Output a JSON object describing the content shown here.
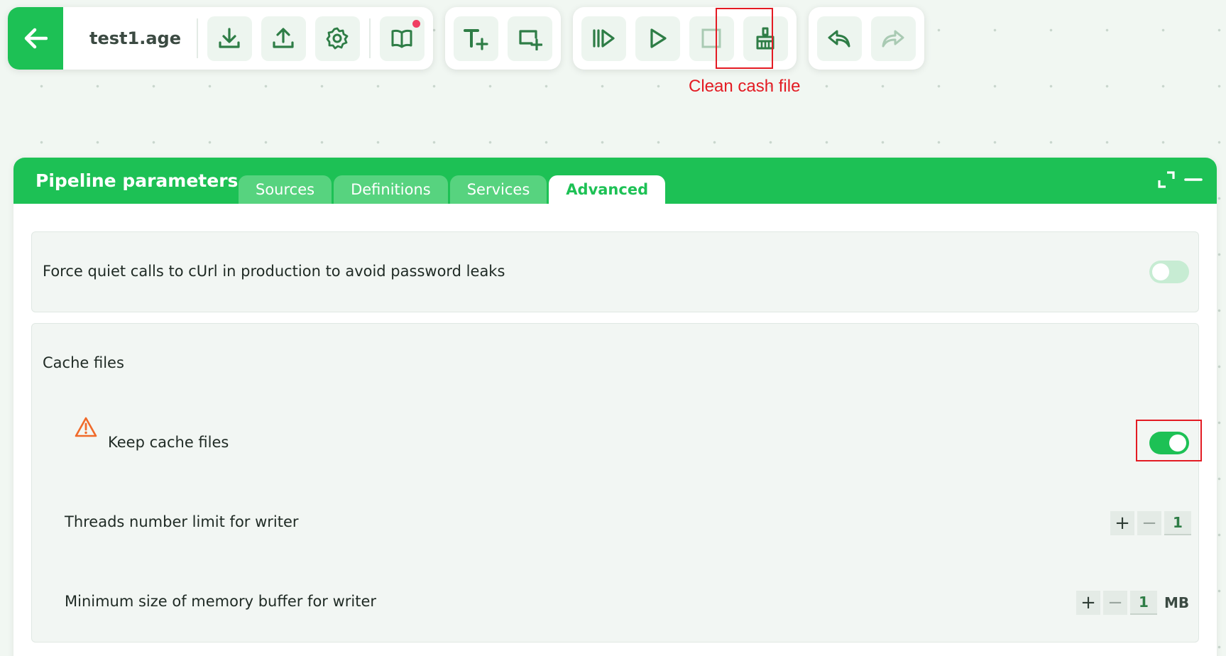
{
  "toolbar": {
    "file_name": "test1.age",
    "groups": [
      {
        "buttons": [
          {
            "icon": "download-icon",
            "disabled": false
          },
          {
            "icon": "upload-icon",
            "disabled": false
          },
          {
            "icon": "gear-icon",
            "disabled": false
          },
          {
            "icon": "book-icon",
            "disabled": false,
            "badge": true
          }
        ]
      },
      {
        "buttons": [
          {
            "icon": "text-add-icon",
            "disabled": false
          },
          {
            "icon": "frame-add-icon",
            "disabled": false
          }
        ]
      },
      {
        "buttons": [
          {
            "icon": "step-run-icon",
            "disabled": false
          },
          {
            "icon": "play-icon",
            "disabled": false
          },
          {
            "icon": "stop-icon",
            "disabled": true
          },
          {
            "icon": "broom-icon",
            "disabled": false
          }
        ]
      },
      {
        "buttons": [
          {
            "icon": "undo-icon",
            "disabled": false
          },
          {
            "icon": "redo-icon",
            "disabled": true
          }
        ]
      }
    ]
  },
  "annotation": {
    "callout": "Clean cash file",
    "color": "#e31b23"
  },
  "panel": {
    "title": "Pipeline parameters",
    "tabs": [
      {
        "label": "Sources",
        "active": false
      },
      {
        "label": "Definitions",
        "active": false
      },
      {
        "label": "Services",
        "active": false
      },
      {
        "label": "Advanced",
        "active": true
      }
    ],
    "force_quiet": {
      "label": "Force quiet calls to cUrl in production to avoid password leaks",
      "enabled": false
    },
    "cache": {
      "section_label": "Cache files",
      "keep_cache": {
        "label": "Keep cache files",
        "enabled": true
      },
      "threads": {
        "label": "Threads number limit for writer",
        "value": "1",
        "plus": "+",
        "minus": "−"
      },
      "buffer": {
        "label": "Minimum size of memory buffer for writer",
        "value": "1",
        "unit": "MB",
        "plus": "+",
        "minus": "−"
      }
    }
  },
  "colors": {
    "accent": "#1dc155",
    "warning": "#f06a2a",
    "highlight": "#e31b23"
  }
}
